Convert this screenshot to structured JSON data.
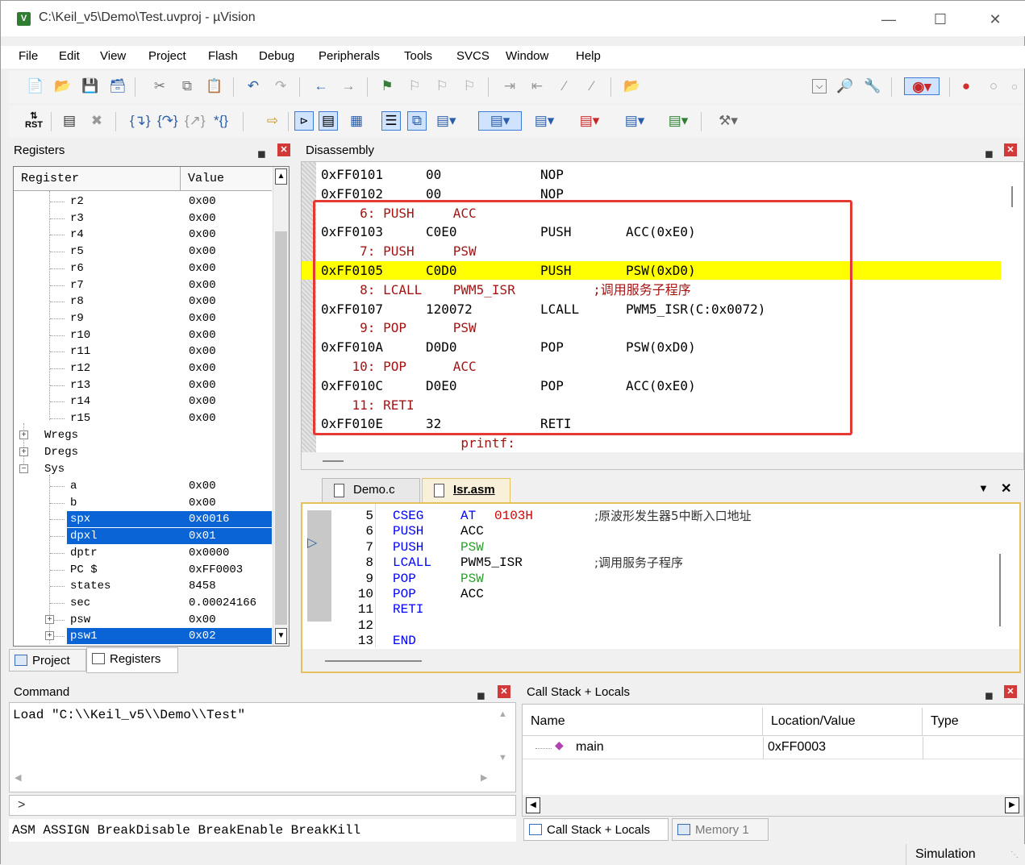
{
  "window": {
    "title": "C:\\Keil_v5\\Demo\\Test.uvproj - µVision",
    "app_icon": "keil-icon"
  },
  "menu": [
    "File",
    "Edit",
    "View",
    "Project",
    "Flash",
    "Debug",
    "Peripherals",
    "Tools",
    "SVCS",
    "Window",
    "Help"
  ],
  "panels": {
    "registers": "Registers",
    "disassembly": "Disassembly",
    "command": "Command",
    "callstack": "Call Stack + Locals"
  },
  "registers": {
    "header": {
      "name": "Register",
      "value": "Value"
    },
    "rows": [
      {
        "name": "r2",
        "value": "0x00"
      },
      {
        "name": "r3",
        "value": "0x00"
      },
      {
        "name": "r4",
        "value": "0x00"
      },
      {
        "name": "r5",
        "value": "0x00"
      },
      {
        "name": "r6",
        "value": "0x00"
      },
      {
        "name": "r7",
        "value": "0x00"
      },
      {
        "name": "r8",
        "value": "0x00"
      },
      {
        "name": "r9",
        "value": "0x00"
      },
      {
        "name": "r10",
        "value": "0x00"
      },
      {
        "name": "r11",
        "value": "0x00"
      },
      {
        "name": "r12",
        "value": "0x00"
      },
      {
        "name": "r13",
        "value": "0x00"
      },
      {
        "name": "r14",
        "value": "0x00"
      },
      {
        "name": "r15",
        "value": "0x00"
      }
    ],
    "groups": [
      "Wregs",
      "Dregs",
      "Sys"
    ],
    "sys_rows": [
      {
        "name": "a",
        "value": "0x00"
      },
      {
        "name": "b",
        "value": "0x00"
      },
      {
        "name": "spx",
        "value": "0x0016"
      },
      {
        "name": "dpxl",
        "value": "0x01"
      },
      {
        "name": "dptr",
        "value": "0x0000"
      },
      {
        "name": "PC  $",
        "value": "0xFF0003"
      },
      {
        "name": "states",
        "value": "8458"
      },
      {
        "name": "sec",
        "value": "0.00024166"
      },
      {
        "name": "psw",
        "value": "0x00"
      },
      {
        "name": "psw1",
        "value": "0x02"
      }
    ],
    "tabs": [
      "Project",
      "Registers"
    ]
  },
  "disassembly": {
    "lines": [
      {
        "kind": "asm",
        "addr": "0xFF0101",
        "code": "00",
        "mnem": "NOP",
        "ops": ""
      },
      {
        "kind": "asm",
        "addr": "0xFF0102",
        "code": "00",
        "mnem": "NOP",
        "ops": ""
      },
      {
        "kind": "src",
        "text": "     6: PUSH     ACC"
      },
      {
        "kind": "asm",
        "addr": "0xFF0103",
        "code": "C0E0",
        "mnem": "PUSH",
        "ops": "ACC(0xE0)"
      },
      {
        "kind": "src",
        "text": "     7: PUSH     PSW"
      },
      {
        "kind": "asm",
        "addr": "0xFF0105",
        "code": "C0D0",
        "mnem": "PUSH",
        "ops": "PSW(0xD0)",
        "current": true
      },
      {
        "kind": "src",
        "text": "     8: LCALL    PWM5_ISR          ;调用服务子程序"
      },
      {
        "kind": "asm",
        "addr": "0xFF0107",
        "code": "120072",
        "mnem": "LCALL",
        "ops": "PWM5_ISR(C:0x0072)"
      },
      {
        "kind": "src",
        "text": "     9: POP      PSW"
      },
      {
        "kind": "asm",
        "addr": "0xFF010A",
        "code": "D0D0",
        "mnem": "POP",
        "ops": "PSW(0xD0)"
      },
      {
        "kind": "src",
        "text": "    10: POP      ACC"
      },
      {
        "kind": "asm",
        "addr": "0xFF010C",
        "code": "D0E0",
        "mnem": "POP",
        "ops": "ACC(0xE0)"
      },
      {
        "kind": "src",
        "text": "    11: RETI"
      },
      {
        "kind": "asm",
        "addr": "0xFF010E",
        "code": "32",
        "mnem": "RETI",
        "ops": ""
      },
      {
        "kind": "src",
        "text": "                  printf:"
      }
    ]
  },
  "editor": {
    "tabs": [
      {
        "label": "Demo.c",
        "active": false
      },
      {
        "label": "Isr.asm",
        "active": true
      }
    ],
    "lines": [
      {
        "n": "5",
        "a": "CSEG",
        "b": "AT",
        "c": "0103H",
        "comment": ";原波形发生器5中断入口地址"
      },
      {
        "n": "6",
        "a": "PUSH",
        "b": "ACC",
        "c": "",
        "comment": ""
      },
      {
        "n": "7",
        "a": "PUSH",
        "b": "PSW",
        "c": "",
        "comment": ""
      },
      {
        "n": "8",
        "a": "LCALL",
        "b": "PWM5_ISR",
        "c": "",
        "comment": ";调用服务子程序"
      },
      {
        "n": "9",
        "a": "POP",
        "b": "PSW",
        "c": "",
        "comment": ""
      },
      {
        "n": "10",
        "a": "POP",
        "b": "ACC",
        "c": "",
        "comment": ""
      },
      {
        "n": "11",
        "a": "RETI",
        "b": "",
        "c": "",
        "comment": ""
      },
      {
        "n": "12",
        "a": "",
        "b": "",
        "c": "",
        "comment": ""
      },
      {
        "n": "13",
        "a": "END",
        "b": "",
        "c": "",
        "comment": ""
      }
    ]
  },
  "command": {
    "output": "Load \"C:\\\\Keil_v5\\\\Demo\\\\Test\"",
    "prompt": ">",
    "help": "ASM ASSIGN BreakDisable BreakEnable BreakKill"
  },
  "callstack": {
    "columns": [
      "Name",
      "Location/Value",
      "Type"
    ],
    "rows": [
      {
        "name": "main",
        "location": "0xFF0003",
        "type": ""
      }
    ],
    "tabs": [
      "Call Stack + Locals",
      "Memory 1"
    ]
  },
  "status": "Simulation",
  "colors": {
    "highlight": "#ffff00",
    "selection": "#0a64d6",
    "box": "#e53935",
    "source": "#a31515"
  }
}
